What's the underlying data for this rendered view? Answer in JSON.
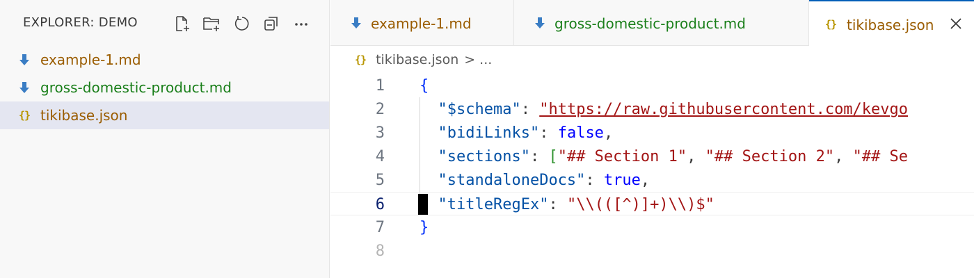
{
  "explorer": {
    "title": "EXPLORER: DEMO",
    "tools": [
      "new-file-icon",
      "new-folder-icon",
      "refresh-icon",
      "collapse-all-icon",
      "more-icon"
    ],
    "files": [
      {
        "name": "example-1.md",
        "icon": "markdown-download-icon",
        "color": "#9a5c00"
      },
      {
        "name": "gross-domestic-product.md",
        "icon": "markdown-download-icon",
        "color": "#1a7f1a"
      },
      {
        "name": "tikibase.json",
        "icon": "json-braces-icon",
        "color": "#9a5c00",
        "selected": true
      }
    ]
  },
  "tabs": [
    {
      "label": "example-1.md",
      "icon": "markdown-download-icon",
      "color": "#9a5c00"
    },
    {
      "label": "gross-domestic-product.md",
      "icon": "markdown-download-icon",
      "color": "#1a7f1a"
    },
    {
      "label": "tikibase.json",
      "icon": "json-braces-icon",
      "color": "#9a5c00",
      "active": true
    }
  ],
  "breadcrumb": {
    "file": "tikibase.json",
    "separator": ">",
    "more": "..."
  },
  "icons": {
    "json": "{}",
    "close": "close-icon"
  },
  "editor": {
    "current_line": 6,
    "line_numbers": [
      "1",
      "2",
      "3",
      "4",
      "5",
      "6",
      "7",
      "8"
    ],
    "lines": [
      {
        "open_brace": "{"
      },
      {
        "key": "\"$schema\"",
        "colon": ": ",
        "url_text": "\"https://raw.githubusercontent.com/kevgo"
      },
      {
        "key": "\"bidiLinks\"",
        "colon": ": ",
        "value": "false",
        "tail": ","
      },
      {
        "key": "\"sections\"",
        "colon": ": ",
        "bracket": "[",
        "values": [
          "\"## Section 1\"",
          ", ",
          "\"## Section 2\"",
          ", ",
          "\"## Se"
        ]
      },
      {
        "key": "\"standaloneDocs\"",
        "colon": ": ",
        "value": "true",
        "tail": ","
      },
      {
        "key": "\"titleRegEx\"",
        "colon": ": ",
        "value": "\"\\\\(([^)]+)\\\\)$\""
      },
      {
        "close_brace": "}"
      },
      {}
    ]
  },
  "colors": {
    "accent": "#005fb8",
    "md_icon": "#3a7dc4",
    "json_icon": "#b89500"
  }
}
